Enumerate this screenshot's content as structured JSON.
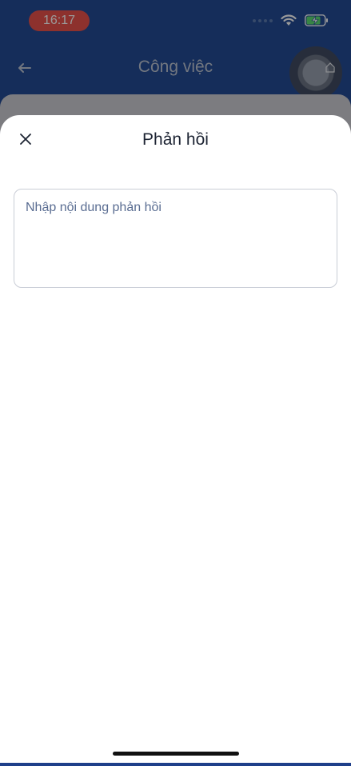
{
  "status_bar": {
    "time": "16:17"
  },
  "app_header": {
    "title": "Công việc",
    "back_icon": "arrow-left-icon",
    "color": "#0d3a8a"
  },
  "sheet": {
    "title": "Phản hồi",
    "close_icon": "close-icon",
    "reply_input": {
      "value": "",
      "placeholder": "Nhập nội dung phản hồi"
    }
  }
}
